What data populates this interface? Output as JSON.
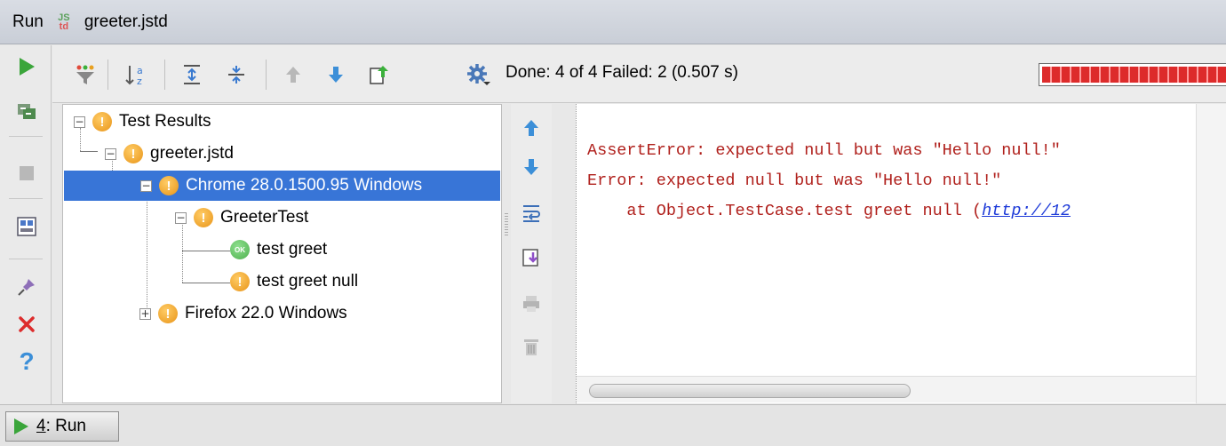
{
  "window": {
    "tool_name": "Run",
    "config_name": "greeter.jstd",
    "config_icon": {
      "top": "JS",
      "bottom": "td"
    }
  },
  "left_toolbar": {
    "items": [
      {
        "name": "run",
        "icon": "play-icon"
      },
      {
        "name": "rerun",
        "icon": "rerun-icon"
      },
      {
        "name": "stop",
        "icon": "stop-icon"
      },
      {
        "name": "layout",
        "icon": "layout-icon"
      },
      {
        "name": "pin",
        "icon": "pin-icon"
      },
      {
        "name": "close",
        "icon": "close-icon"
      },
      {
        "name": "help",
        "icon": "help-icon"
      }
    ]
  },
  "top_toolbar": {
    "status_text": "Done: 4 of 4  Failed: 2  (0.507 s)",
    "progress_fraction": 1.0,
    "progress_color": "#dd2b2b"
  },
  "tree": {
    "root": {
      "label": "Test Results",
      "status": "warning"
    },
    "nodes": [
      {
        "label": "greeter.jstd",
        "status": "warning"
      },
      {
        "label": "Chrome 28.0.1500.95 Windows",
        "status": "warning",
        "selected": true
      },
      {
        "label": "GreeterTest",
        "status": "warning"
      },
      {
        "label": "test greet",
        "status": "ok",
        "badge": "OK"
      },
      {
        "label": "test greet null",
        "status": "warning"
      },
      {
        "label": "Firefox 22.0 Windows",
        "status": "warning",
        "collapsed": true
      }
    ]
  },
  "console": {
    "line1": "AssertError: expected null but was \"Hello null!\"",
    "line2": "Error: expected null but was \"Hello null!\"",
    "line3_prefix": "    at Object.TestCase.test greet null (",
    "line3_link": "http://12"
  },
  "bottom": {
    "tab_number": "4",
    "tab_label": ": Run"
  }
}
